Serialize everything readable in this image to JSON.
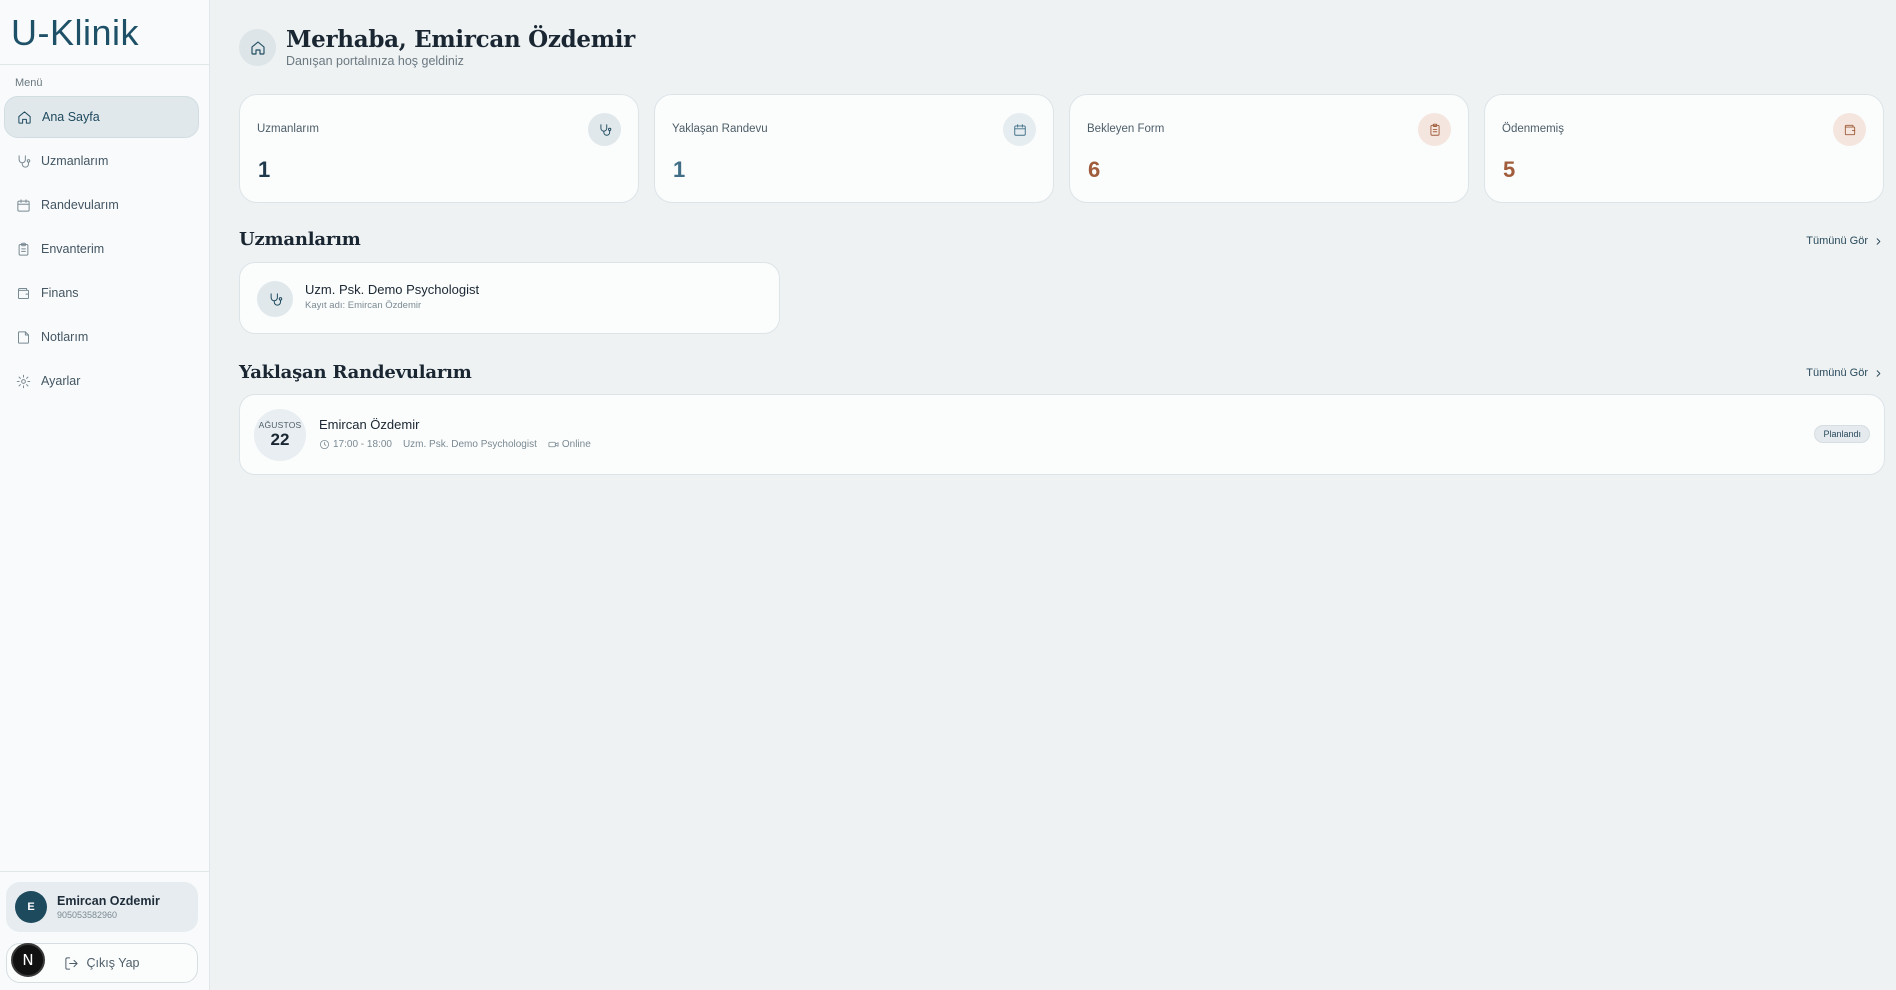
{
  "app": {
    "logo": "U-Klinik"
  },
  "sidebar": {
    "menu_heading": "Menü",
    "items": [
      {
        "label": "Ana Sayfa",
        "icon": "home-icon",
        "active": true
      },
      {
        "label": "Uzmanlarım",
        "icon": "stethoscope-icon"
      },
      {
        "label": "Randevularım",
        "icon": "calendar-icon"
      },
      {
        "label": "Envanterim",
        "icon": "clipboard-icon"
      },
      {
        "label": "Finans",
        "icon": "wallet-icon"
      },
      {
        "label": "Notlarım",
        "icon": "note-icon"
      },
      {
        "label": "Ayarlar",
        "icon": "gear-icon"
      }
    ],
    "user": {
      "initial": "E",
      "name": "Emircan Ozdemir",
      "phone": "905053582960"
    },
    "logout_label": "Çıkış Yap",
    "dev_badge": "N"
  },
  "header": {
    "greeting": "Merhaba, Emircan Özdemir",
    "subtitle": "Danışan portalınıza hoş geldiniz"
  },
  "stats": [
    {
      "label": "Uzmanlarım",
      "value": "1",
      "icon": "stethoscope-icon",
      "color": "#1e3a4c",
      "icon_bg": "#e0e8ec",
      "icon_color": "#1e4a5e"
    },
    {
      "label": "Yaklaşan Randevu",
      "value": "1",
      "icon": "calendar-icon",
      "color": "#3f6e86",
      "icon_bg": "#e6edf0",
      "icon_color": "#3f6e86"
    },
    {
      "label": "Bekleyen Form",
      "value": "6",
      "icon": "clipboard-icon",
      "color": "#a05c3b",
      "icon_bg": "#f4e6de",
      "icon_color": "#a05c3b"
    },
    {
      "label": "Ödenmemiş",
      "value": "5",
      "icon": "wallet-icon",
      "color": "#a05c3b",
      "icon_bg": "#f4e6de",
      "icon_color": "#a05c3b"
    }
  ],
  "experts_section": {
    "title": "Uzmanlarım",
    "see_all": "Tümünü Gör",
    "items": [
      {
        "name": "Uzm. Psk. Demo Psychologist",
        "sub": "Kayıt adı: Emircan Özdemir"
      }
    ]
  },
  "appointments_section": {
    "title": "Yaklaşan Randevularım",
    "see_all": "Tümünü Gör",
    "items": [
      {
        "month": "AĞUSTOS",
        "day": "22",
        "name": "Emircan Özdemir",
        "time": "17:00 - 18:00",
        "expert": "Uzm. Psk. Demo Psychologist",
        "mode": "Online",
        "status": "Planlandı"
      }
    ]
  }
}
